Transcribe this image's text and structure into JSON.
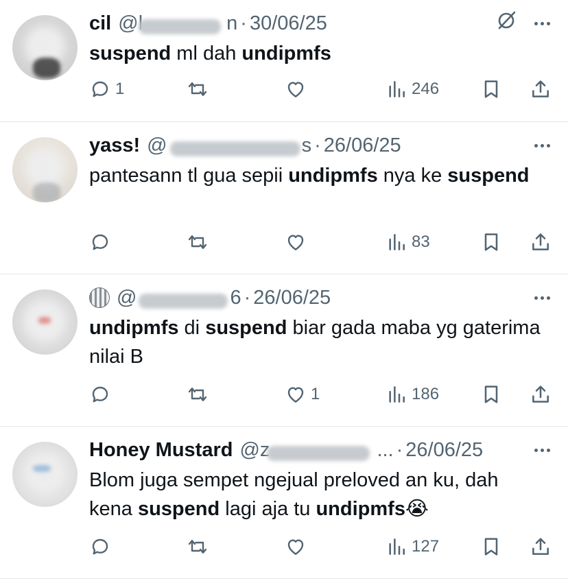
{
  "tweets": [
    {
      "name": "cil",
      "handle": "@l",
      "date": "30/06/25",
      "text": "suspend ml dah undipmfs",
      "replies": "1",
      "likes": "",
      "views": "246",
      "has_grok": true
    },
    {
      "name": "yass!",
      "handle": "@",
      "date": "26/06/25",
      "text": "pantesann tl gua sepii undipmfs nya ke suspend",
      "replies": "",
      "likes": "",
      "views": "83"
    },
    {
      "name": "",
      "handle": "@",
      "date": "26/06/25",
      "text": "undipmfs di suspend biar gada maba yg gaterima nilai B",
      "replies": "",
      "likes": "1",
      "views": "186"
    },
    {
      "name": "Honey Mustard",
      "handle": "@z",
      "date": "26/06/25",
      "text": "Blom juga sempet ngejual preloved an ku, dah kena suspend lagi aja tu undipmfs😭",
      "replies": "",
      "likes": "",
      "views": "127"
    }
  ],
  "handle_suffix": "...",
  "separator": "·",
  "icons": {
    "reply": "reply-icon",
    "retweet": "retweet-icon",
    "like": "heart-icon",
    "views": "views-icon",
    "bookmark": "bookmark-icon",
    "share": "share-icon",
    "grok": "grok-icon",
    "more": "more-icon"
  },
  "colors": {
    "text": "#0f1419",
    "muted": "#536471",
    "divider": "#e6e8ea"
  }
}
